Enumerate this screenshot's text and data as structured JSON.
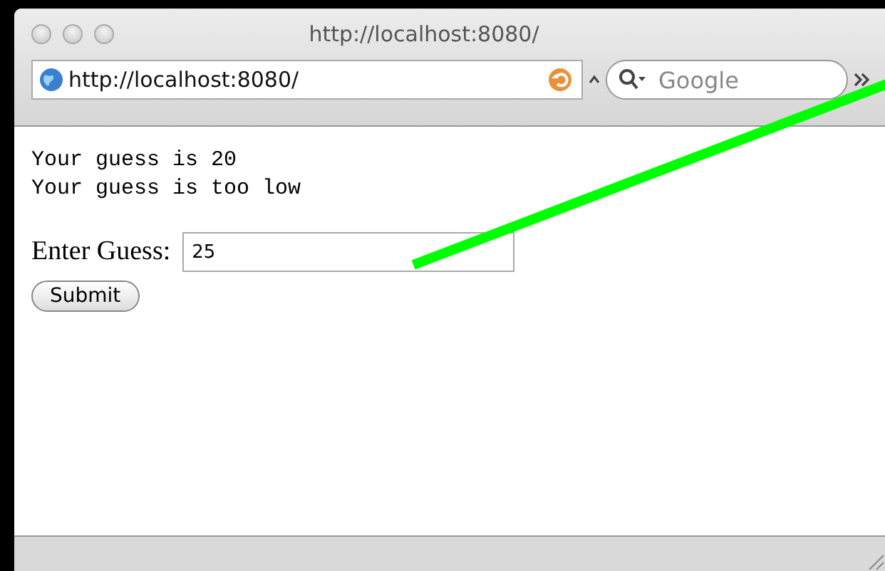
{
  "window": {
    "title": "http://localhost:8080/"
  },
  "toolbar": {
    "address": "http://localhost:8080/",
    "search": {
      "placeholder": "Google"
    }
  },
  "page": {
    "output_lines": [
      "Your guess is 20",
      "Your guess is too low"
    ],
    "form": {
      "label": "Enter Guess:",
      "value": "25",
      "button": "Submit"
    }
  }
}
